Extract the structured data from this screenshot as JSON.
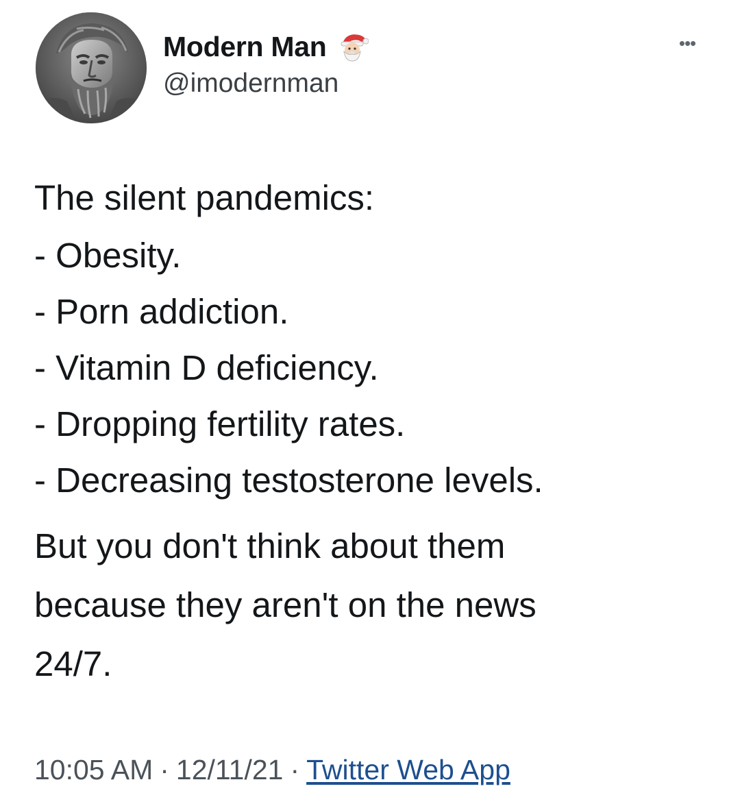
{
  "author": {
    "display_name": "Modern Man",
    "handle": "@imodernman",
    "badge_icon": "santa-emoji-icon",
    "avatar": "bearded-statue-avatar"
  },
  "more_icon": "ellipsis-icon",
  "tweet": {
    "intro": "The silent pandemics:",
    "items": [
      "- Obesity.",
      "- Porn addiction.",
      "- Vitamin D deficiency.",
      "- Dropping fertility rates.",
      "- Decreasing testosterone levels."
    ],
    "closing_lines": [
      "But you don't think about them",
      "because they aren't on the news",
      "24/7."
    ]
  },
  "meta": {
    "time": "10:05 AM",
    "separator": "·",
    "date": "12/11/21",
    "source": "Twitter Web App"
  },
  "colors": {
    "text": "#14171a",
    "secondary_text": "#4b5259",
    "link": "#1d4f8f",
    "background": "#ffffff"
  }
}
